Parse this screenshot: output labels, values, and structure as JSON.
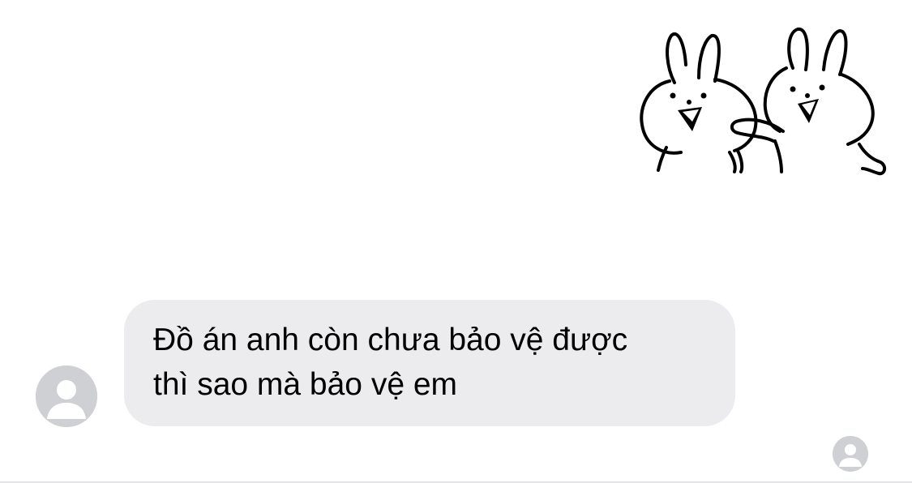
{
  "conversation": {
    "sticker": {
      "icon": "two-bunnies-laughing-sticker"
    },
    "incoming_message": {
      "line1": "Đồ án anh còn chưa bảo vệ được",
      "line2": "thì sao mà bảo vệ em",
      "sender_avatar_icon": "default-user-avatar-icon"
    },
    "read_receipt": {
      "icon": "read-receipt-avatar-icon"
    }
  },
  "colors": {
    "background": "#ffffff",
    "bubble": "#ececee",
    "avatar": "#cfd0d3",
    "text": "#000000"
  }
}
